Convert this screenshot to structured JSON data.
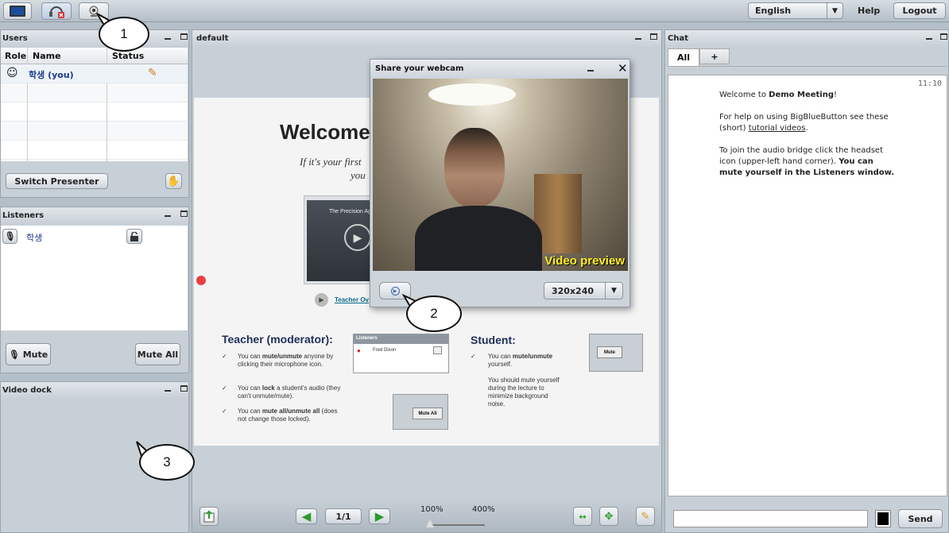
{
  "toolbar": {
    "language": "English",
    "help": "Help",
    "logout": "Logout"
  },
  "users": {
    "title": "Users",
    "columns": [
      "Role",
      "Name",
      "Status"
    ],
    "rows": [
      {
        "name": "학생 (you)"
      }
    ],
    "switch_presenter": "Switch Presenter"
  },
  "listeners": {
    "title": "Listeners",
    "items": [
      {
        "name": "학생"
      }
    ],
    "mute": "Mute",
    "mute_all": "Mute All"
  },
  "video_dock": {
    "title": "Video dock"
  },
  "presentation": {
    "title": "default",
    "slide": {
      "welcome": "Welcome",
      "intro_line1": "If it's your first",
      "intro_line2": "you",
      "video_thumb_title": "The Precision Ag",
      "teacher_link": "Teacher Ov",
      "teacher_heading": "Teacher (moderator):",
      "teacher_items": [
        {
          "pre": "You can ",
          "bold": "mute/unmute",
          "post": " anyone by clicking their microphone icon."
        },
        {
          "pre": "You can ",
          "bold": "lock",
          "post": " a student's audio (they can't unmute/mute)."
        },
        {
          "pre": "You can ",
          "bold": "mute all/unmute all",
          "post": " (does not change those locked)."
        }
      ],
      "listeners_box_title": "Listeners",
      "listeners_box_name": "Fred Dixon",
      "mute_all_btn": "Mute All",
      "student_heading": "Student:",
      "student_items": [
        {
          "pre": "You can ",
          "bold": "mute/unmute",
          "post": " yourself."
        }
      ],
      "student_note": "You should mute yourself during the lecture to minimize background noise.",
      "student_mute_btn": "Mute"
    },
    "page": "1/1",
    "zoom_min": "100%",
    "zoom_max": "400%"
  },
  "webcam": {
    "title": "Share your webcam",
    "preview_label": "Video preview",
    "resolution": "320x240"
  },
  "chat": {
    "title": "Chat",
    "tabs": [
      "All",
      "+"
    ],
    "time": "11:10",
    "welcome_pre": "Welcome to ",
    "welcome_bold": "Demo Meeting",
    "welcome_post": "!",
    "help_pre": "For help on using BigBlueButton see these (short) ",
    "help_link": "tutorial videos",
    "help_post": ".",
    "audio_pre": "To join the audio bridge click the headset icon (upper-left hand corner). ",
    "audio_bold": "You can mute yourself in the Listeners window.",
    "send": "Send",
    "color": "#000000"
  },
  "callouts": [
    "1",
    "2",
    "3"
  ]
}
